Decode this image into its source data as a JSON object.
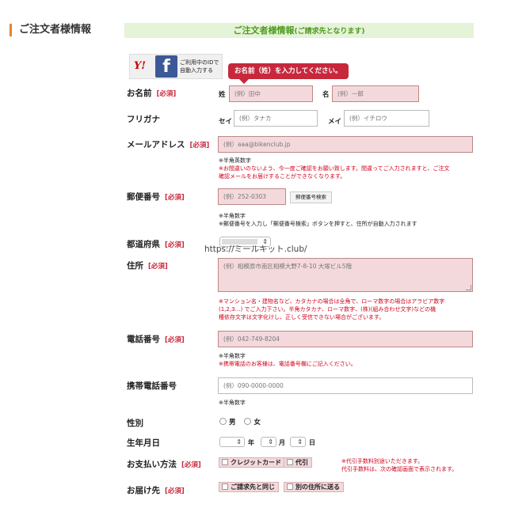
{
  "section": {
    "side_title": "ご注文者様情報",
    "banner_title": "ご注文者様情報",
    "banner_sub": "(ご請求先となります)"
  },
  "social_login": {
    "yahoo_mark": "Y!",
    "facebook_mark": "f",
    "text_line1": "ご利用中のIDで",
    "text_line2": "自動入力する"
  },
  "tooltip": "お名前（姓）を入力してください。",
  "required_label": "[必須]",
  "name": {
    "label": "お名前",
    "last_label": "姓",
    "last_placeholder": "(例）田中",
    "first_label": "名",
    "first_placeholder": "(例）一郎"
  },
  "furigana": {
    "label": "フリガナ",
    "sei_label": "セイ",
    "sei_placeholder": "(例）タナカ",
    "mei_label": "メイ",
    "mei_placeholder": "(例）イチロウ"
  },
  "email": {
    "label": "メールアドレス",
    "placeholder": "(例）aaa@bikenclub.jp",
    "note1": "※半角英数字",
    "note2": "※お間違いのないよう、今一度ご確認をお願い致します。間違ってご入力されますと、ご注文",
    "note3": "確認メールをお届けすることができなくなります。"
  },
  "postal": {
    "label": "郵便番号",
    "placeholder": "(例）252-0303",
    "search_button": "郵便番号検索",
    "note1": "※半角数字",
    "note2": "※郵便番号を入力し「郵便番号検索」ボタンを押すと、住所が自動入力されます"
  },
  "prefecture": {
    "label": "都道府県"
  },
  "watermark": "https://ミールキット.club/",
  "address": {
    "label": "住所",
    "placeholder": "(例）相模原市南区相模大野7-8-10 大塚ビル5階",
    "note1": "※マンション名・建物名など、カタカナの場合は全角で、ローマ数字の場合はアラビア数字",
    "note2": "(1,2,3…) でご入力下さい。半角カタカナ、ローマ数字、(株)(組み合わせ文字)などの機",
    "note3": "種依存文字は文字化けし、正しく受信できない場合がございます。"
  },
  "phone": {
    "label": "電話番号",
    "placeholder": "(例）042-749-8204",
    "note1": "※半角数字",
    "note2": "※携帯電話のお客様は、電話番号欄にご記入ください。"
  },
  "mobile": {
    "label": "携帯電話番号",
    "placeholder": "(例）090-0000-0000",
    "note1": "※半角数字"
  },
  "gender": {
    "label": "性別",
    "male": "男",
    "female": "女"
  },
  "birthday": {
    "label": "生年月日",
    "year": "年",
    "month": "月",
    "day": "日"
  },
  "payment": {
    "label": "お支払い方法",
    "option1": "クレジットカード",
    "option2": "代引",
    "note1": "※代引手数料別途いただきます。",
    "note2": "代引手数料は、次の確認画面で表示されます。"
  },
  "delivery": {
    "label": "お届け先",
    "option1": "ご請求先と同じ",
    "option2": "別の住所に送る"
  },
  "colors": {
    "accent_orange": "#e8842a",
    "banner_green": "#e5f3d8",
    "banner_text": "#4e9a1f",
    "required_red": "#c8283c",
    "input_pink": "#f4d9dc"
  }
}
